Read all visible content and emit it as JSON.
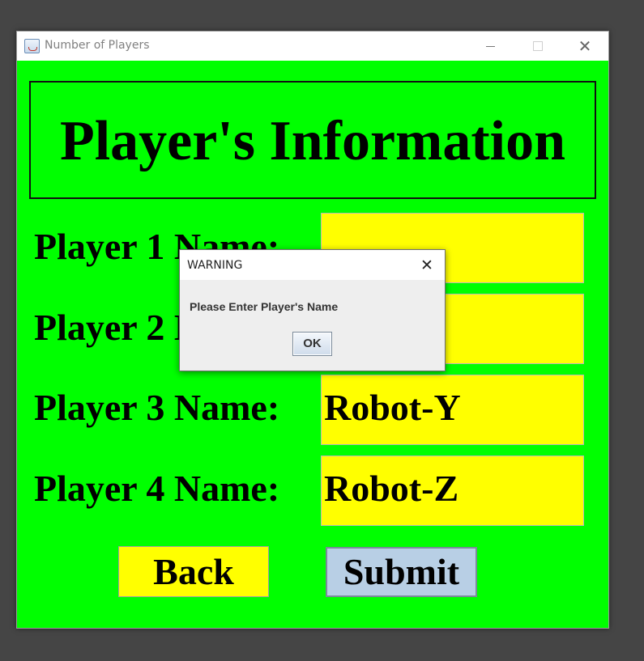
{
  "window": {
    "title": "Number of Players",
    "close_glyph": "✕",
    "icon": "java-cup-icon"
  },
  "header": {
    "title": "Player's Information"
  },
  "players": [
    {
      "label": "Player 1 Name:",
      "value": ""
    },
    {
      "label": "Player 2 Name:",
      "value": ""
    },
    {
      "label": "Player 3 Name:",
      "value": "Robot-Y"
    },
    {
      "label": "Player 4 Name:",
      "value": "Robot-Z"
    }
  ],
  "buttons": {
    "back": "Back",
    "submit": "Submit"
  },
  "dialog": {
    "title": "WARNING",
    "close_glyph": "✕",
    "message": "Please Enter Player's Name",
    "ok": "OK"
  },
  "colors": {
    "panel_background": "#00ff00",
    "field_background": "#ffff00",
    "submit_background": "#b8cfe5",
    "desktop": "#454545"
  }
}
